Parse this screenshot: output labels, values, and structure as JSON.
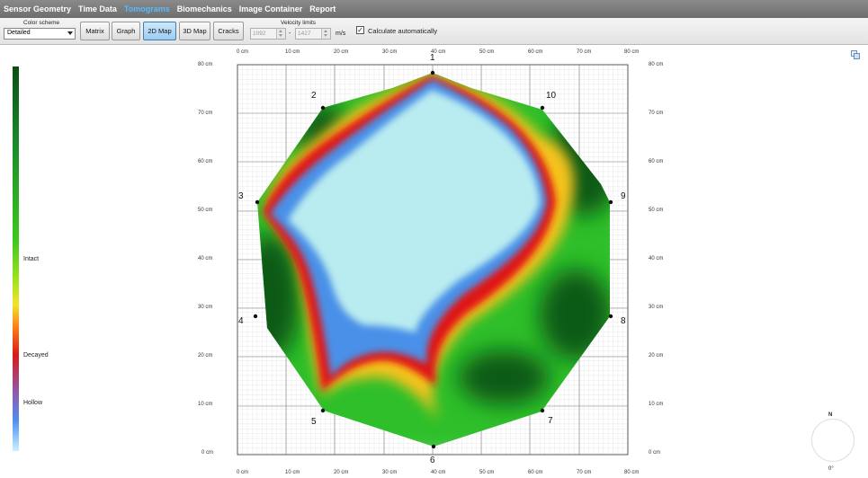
{
  "menu": {
    "items": [
      {
        "label": "Sensor Geometry",
        "name": "menu-sensor-geometry",
        "active": false
      },
      {
        "label": "Time Data",
        "name": "menu-time-data",
        "active": false
      },
      {
        "label": "Tomograms",
        "name": "menu-tomograms",
        "active": true
      },
      {
        "label": "Biomechanics",
        "name": "menu-biomechanics",
        "active": false
      },
      {
        "label": "Image Container",
        "name": "menu-image-container",
        "active": false
      },
      {
        "label": "Report",
        "name": "menu-report",
        "active": false
      }
    ]
  },
  "toolbar": {
    "color_scheme_label": "Color scheme",
    "color_scheme_value": "Detailed",
    "buttons": [
      {
        "label": "Matrix",
        "name": "matrix-button",
        "selected": false
      },
      {
        "label": "Graph",
        "name": "graph-button",
        "selected": false
      },
      {
        "label": "2D Map",
        "name": "2d-map-button",
        "selected": true
      },
      {
        "label": "3D Map",
        "name": "3d-map-button",
        "selected": false
      },
      {
        "label": "Cracks",
        "name": "cracks-button",
        "selected": false
      }
    ],
    "velocity_limits_label": "Velocity limits",
    "velocity_min": "1092",
    "velocity_separator": "-",
    "velocity_max": "1427",
    "velocity_unit": "m/s",
    "calc_auto_label": "Calculate automatically",
    "calc_auto_checked": true
  },
  "legend": {
    "intact": "Intact",
    "decayed": "Decayed",
    "hollow": "Hollow"
  },
  "axes": {
    "x_ticks": [
      "0 cm",
      "10 cm",
      "20 cm",
      "30 cm",
      "40 cm",
      "50 cm",
      "60 cm",
      "70 cm",
      "80 cm"
    ],
    "y_ticks": [
      "80 cm",
      "70 cm",
      "60 cm",
      "50 cm",
      "40 cm",
      "30 cm",
      "20 cm",
      "10 cm",
      "0 cm"
    ]
  },
  "sensors": {
    "labels": [
      "1",
      "2",
      "3",
      "4",
      "5",
      "6",
      "7",
      "8",
      "9",
      "10"
    ]
  },
  "compass": {
    "north": "N",
    "heading": "0°"
  },
  "colors": {
    "hollow": "#b9ecf0",
    "hollow_edge": "#4a90e8",
    "decayed": "#e01818",
    "transition": "#f5c21a",
    "intact": "#2fbf2a",
    "intact_dark": "#0b5a14",
    "menu_active": "#5ab8ff"
  }
}
